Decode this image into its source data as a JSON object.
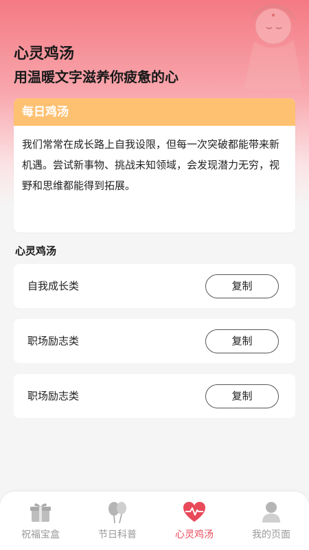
{
  "header": {
    "title": "心灵鸡汤",
    "subtitle": "用温暖文字滋养你疲惫的心"
  },
  "daily": {
    "heading": "每日鸡汤",
    "text": "我们常常在成长路上自我设限，但每一次突破都能带来新机遇。尝试新事物、挑战未知领域，会发现潜力无穷，视野和思维都能得到拓展。"
  },
  "section": {
    "title": "心灵鸡汤"
  },
  "items": [
    {
      "label": "自我成长类",
      "button": "复制"
    },
    {
      "label": "职场励志类",
      "button": "复制"
    },
    {
      "label": "职场励志类",
      "button": "复制"
    }
  ],
  "tabs": [
    {
      "label": "祝福宝盒",
      "icon": "gift-icon",
      "active": false
    },
    {
      "label": "节日科普",
      "icon": "balloon-icon",
      "active": false
    },
    {
      "label": "心灵鸡汤",
      "icon": "heartbeat-icon",
      "active": true
    },
    {
      "label": "我的页面",
      "icon": "user-icon",
      "active": false
    }
  ],
  "colors": {
    "accent": "#e84a5a",
    "card_header": "#fec172",
    "header_gradient_top": "#f47a84",
    "tab_inactive": "#999999"
  }
}
